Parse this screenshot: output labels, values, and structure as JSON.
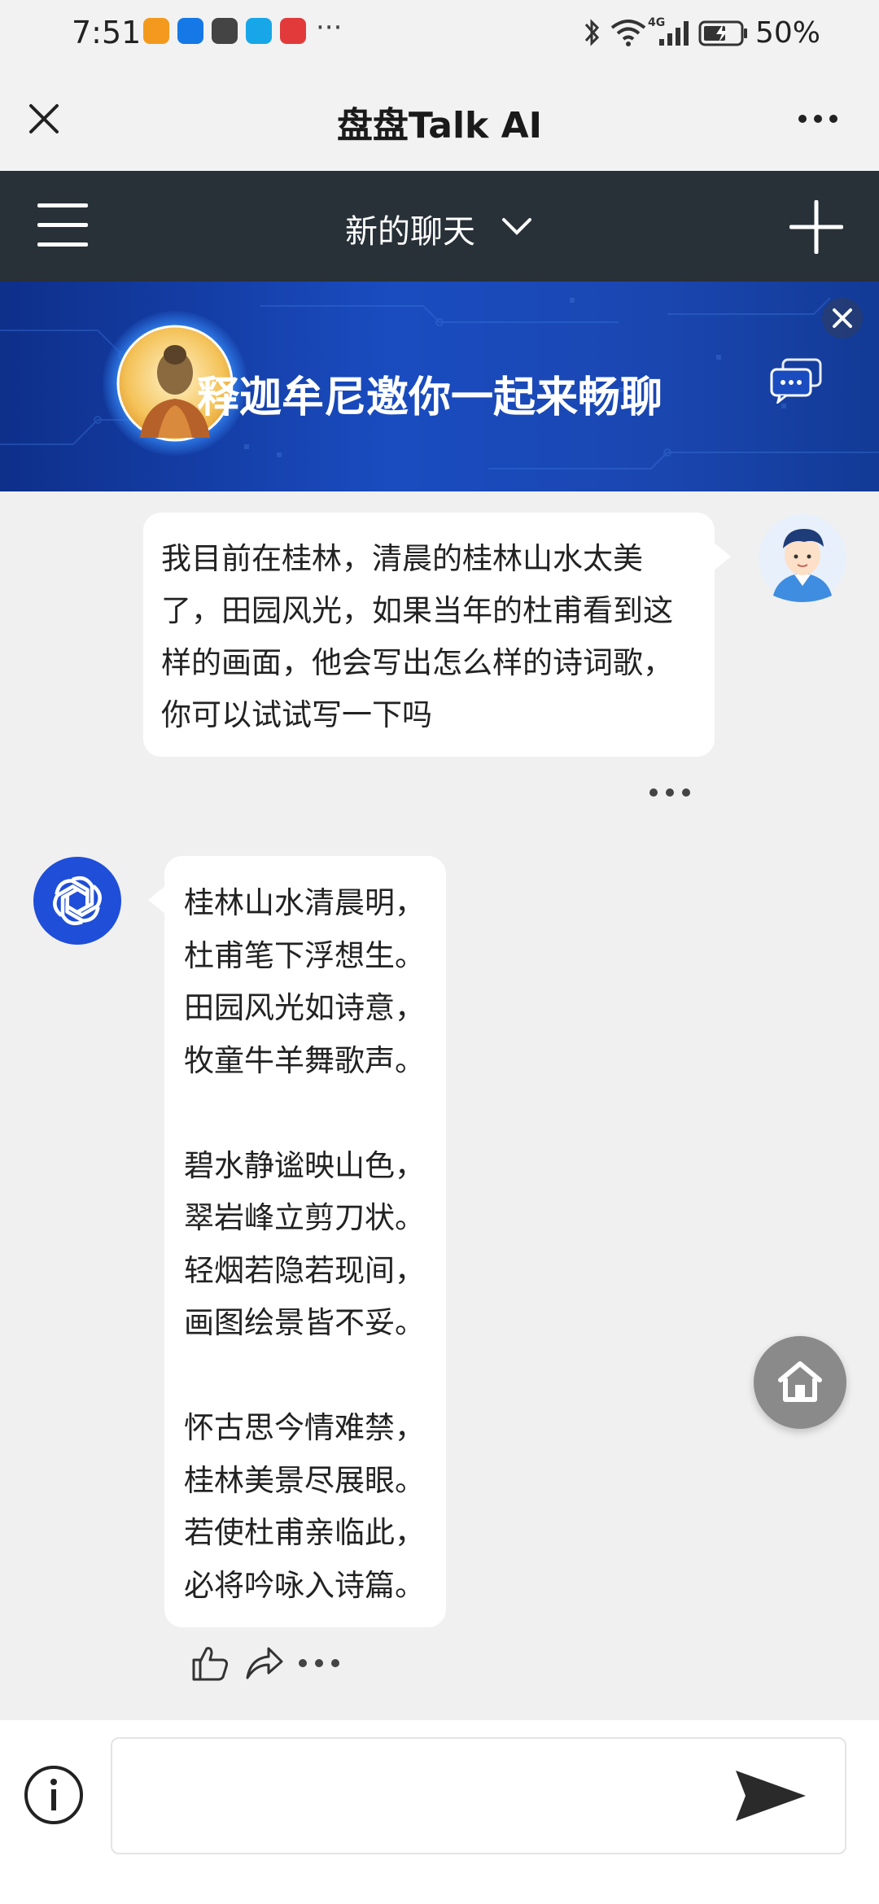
{
  "status_bar": {
    "time": "7:51",
    "more": "···",
    "battery": "50%",
    "network": "4G",
    "app_icons": [
      "orange-app-icon",
      "blue-bulb-app-icon",
      "huawei-app-icon",
      "search-app-icon",
      "red-book-app-icon"
    ],
    "app_colors": [
      "#f39a1e",
      "#1478e6",
      "#444444",
      "#17a7e8",
      "#e23a3a"
    ]
  },
  "title_bar": {
    "title": "盘盘Talk AI",
    "close_icon": "close-icon",
    "more_icon": "more-dots-icon"
  },
  "nav_bar": {
    "title": "新的聊天",
    "menu_icon": "hamburger-menu-icon",
    "dropdown_icon": "chevron-down-icon",
    "add_icon": "plus-icon",
    "background": "#283038"
  },
  "banner": {
    "text": "释迦牟尼邀你一起来畅聊",
    "close_icon": "close-icon",
    "avatar": "buddha-avatar",
    "chat_icon": "chat-bubbles-icon"
  },
  "messages": [
    {
      "role": "user",
      "text": "我目前在桂林，清晨的桂林山水太美了，田园风光，如果当年的杜甫看到这样的画面，他会写出怎么样的诗词歌，你可以试试写一下吗",
      "avatar": "user-avatar"
    },
    {
      "role": "assistant",
      "avatar": "openai-logo",
      "lines": [
        "桂林山水清晨明，",
        "杜甫笔下浮想生。",
        "田园风光如诗意，",
        "牧童牛羊舞歌声。",
        "",
        "碧水静谧映山色，",
        "翠岩峰立剪刀状。",
        "轻烟若隐若现间，",
        "画图绘景皆不妥。",
        "",
        "怀古思今情难禁，",
        "桂林美景尽展眼。",
        "若使杜甫亲临此，",
        "必将吟咏入诗篇。"
      ]
    }
  ],
  "actions": {
    "like_icon": "thumbs-up-icon",
    "share_icon": "share-icon",
    "more_icon": "more-dots-icon"
  },
  "floating": {
    "home_icon": "home-icon"
  },
  "composer": {
    "info_icon": "info-icon",
    "input_value": "",
    "send_icon": "send-icon"
  }
}
